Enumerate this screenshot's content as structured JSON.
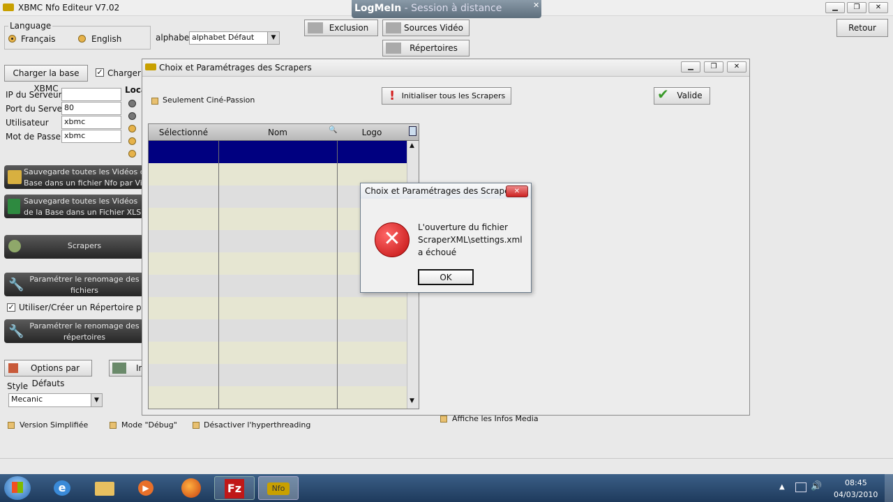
{
  "app": {
    "title": "XBMC Nfo Editeur V7.02",
    "logmein_brand": "LogMeIn",
    "logmein_session": " - Session à distance"
  },
  "language": {
    "label": "Language",
    "options": [
      "Français",
      "English"
    ],
    "selected": "Français"
  },
  "alphabet": {
    "label": "alphabet",
    "value": "alphabet Défaut"
  },
  "top_buttons": {
    "exclusion": "Exclusion",
    "sources_video": "Sources Vidéo",
    "repertoires_video": "Répertoires Vidéo",
    "retour": "Retour"
  },
  "left": {
    "charger_base": "Charger la base XBMC",
    "charger_la": "Charger la",
    "loca": "Loca",
    "ip_label": "IP du Serveur",
    "ip_value": "",
    "port_label": "Port du Serveur",
    "port_value": "80",
    "user_label": "Utilisateur",
    "user_value": "xbmc",
    "pass_label": "Mot de Passe",
    "pass_value": "xbmc",
    "save_nfo_line1": "Sauvegarde toutes les Vidéos de la",
    "save_nfo_line2": "Base dans un fichier Nfo par Vidéo",
    "save_xls_line1": "Sauvegarde toutes les Vidéos",
    "save_xls_line2": "de la Base dans un Fichier XLS",
    "scrapers": "Scrapers",
    "rename_files_line1": "Paramétrer le renomage des",
    "rename_files_line2": "fichiers",
    "use_dir": "Utiliser/Créer un Répertoire par Fi",
    "rename_dirs_line1": "Paramétrer le renomage des",
    "rename_dirs_line2": "répertoires",
    "options_defaut": "Options par Défauts",
    "im": "Im",
    "style_label": "Style",
    "style_value": "Mecanic",
    "version_simplifiee": "Version Simplifiée",
    "mode_debug": "Mode \"Débug\"",
    "desactiver_ht": "Désactiver l'hyperthreading",
    "affiche_infos": "Affiche les Infos Media"
  },
  "scraper_window": {
    "title": "Choix et Paramétrages des Scrapers",
    "seulement": "Seulement Ciné-Passion",
    "init_all": "Initialiser tous les Scrapers",
    "valide": "Valide",
    "columns": [
      "Sélectionné",
      "Nom",
      "Logo"
    ]
  },
  "dialog": {
    "title": "Choix et Paramétrages des Scrapers",
    "line1": "L'ouverture du fichier",
    "line2": "ScraperXML\\settings.xml",
    "line3": "a échoué",
    "ok": "OK"
  },
  "taskbar": {
    "time": "08:45",
    "date": "04/03/2010",
    "nfo_label": "Nfo"
  },
  "colors": {
    "selected_row": "#000080",
    "row_alt_a": "#e6e6d2",
    "row_alt_b": "#dedede",
    "error_red": "#d42020"
  }
}
